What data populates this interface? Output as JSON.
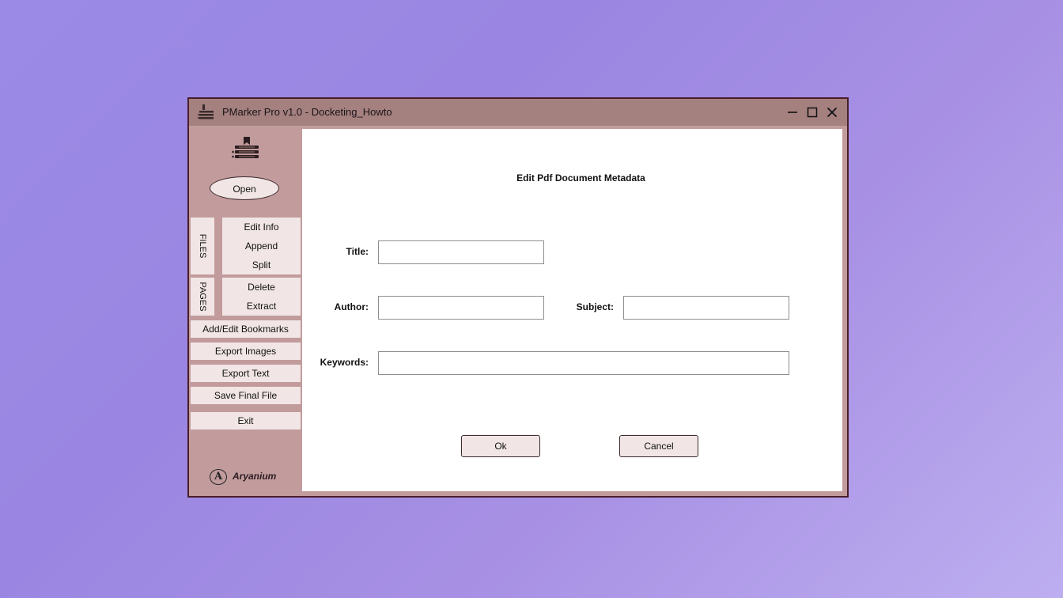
{
  "window": {
    "title": "PMarker Pro v1.0 - Docketing_Howto",
    "minimize_icon": "minimize-icon",
    "maximize_icon": "maximize-icon",
    "close_icon": "close-icon"
  },
  "sidebar": {
    "logo_icon": "bookmark-stack-icon",
    "open_label": "Open",
    "files_tab": "FILES",
    "files_items": [
      "Edit Info",
      "Append",
      "Split"
    ],
    "pages_tab": "PAGES",
    "pages_items": [
      "Delete",
      "Extract"
    ],
    "add_edit_bookmarks": "Add/Edit Bookmarks",
    "export_images": "Export Images",
    "export_text": "Export Text",
    "save_final_file": "Save Final File",
    "exit": "Exit",
    "brand_mark": "A",
    "brand_name": "Aryanium"
  },
  "form": {
    "heading": "Edit Pdf Document Metadata",
    "title_label": "Title:",
    "title_value": "",
    "author_label": "Author:",
    "author_value": "",
    "subject_label": "Subject:",
    "subject_value": "",
    "keywords_label": "Keywords:",
    "keywords_value": "",
    "ok_label": "Ok",
    "cancel_label": "Cancel"
  },
  "colors": {
    "desktop": "#9b8be6",
    "sidebar": "#c29b9c",
    "titlebar": "#a4807f",
    "button": "#f1e6e5",
    "window_border": "#4a1e2a"
  }
}
